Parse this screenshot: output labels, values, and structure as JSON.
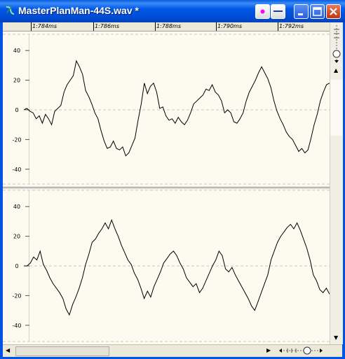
{
  "window": {
    "title": "MasterPlanMan-44S.wav *",
    "icon": "waveform-app-icon",
    "buttons": [
      "record-indicator-icon",
      "minimize-icon",
      "maximize-icon",
      "close-icon"
    ]
  },
  "colors": {
    "titlebar": "#0058e6",
    "background": "#fdfaef",
    "waveform": "#000000",
    "record_dot": "#ff00ff"
  },
  "ruler": {
    "labels": [
      "1:784ms",
      "1:786ms",
      "1:788ms",
      "1:790ms",
      "1:792ms"
    ]
  },
  "channels": [
    {
      "name": "",
      "y_ticks": [
        "40",
        "20",
        "0",
        "-20",
        "-40"
      ],
      "tick_values": [
        40,
        20,
        0,
        -20,
        -40
      ],
      "samples": [
        0,
        1,
        -1,
        -2,
        -6,
        -4,
        -9,
        -3,
        -6,
        -10,
        -1,
        1,
        3,
        12,
        17,
        20,
        23,
        33,
        29,
        24,
        13,
        9,
        4,
        -2,
        -6,
        -14,
        -21,
        -26,
        -25,
        -21,
        -26,
        -27,
        -25,
        -31,
        -29,
        -24,
        -19,
        -7,
        4,
        18,
        11,
        16,
        18,
        12,
        1,
        2,
        -4,
        -7,
        -6,
        -9,
        -5,
        -8,
        -10,
        -7,
        -2,
        4,
        6,
        8,
        10,
        14,
        13,
        17,
        12,
        10,
        6,
        -2,
        0,
        -2,
        -8,
        -9,
        -6,
        -2,
        6,
        12,
        16,
        20,
        25,
        29,
        25,
        21,
        15,
        6,
        -1,
        -6,
        -10,
        -15,
        -18,
        -20,
        -24,
        -28,
        -26,
        -29,
        -27,
        -19,
        -10,
        -3,
        6,
        12,
        17,
        18
      ]
    },
    {
      "name": "",
      "y_ticks": [
        "40",
        "20",
        "0",
        "-20",
        "-40"
      ],
      "tick_values": [
        40,
        20,
        0,
        -20,
        -40
      ],
      "samples": [
        0,
        0,
        2,
        6,
        4,
        10,
        1,
        -3,
        -8,
        -12,
        -15,
        -18,
        -22,
        -29,
        -33,
        -26,
        -21,
        -15,
        -8,
        1,
        8,
        16,
        18,
        22,
        25,
        29,
        25,
        31,
        25,
        20,
        14,
        9,
        4,
        1,
        -5,
        -9,
        -15,
        -22,
        -17,
        -21,
        -14,
        -9,
        -4,
        2,
        5,
        8,
        10,
        7,
        2,
        -2,
        -8,
        -11,
        -14,
        -12,
        -18,
        -15,
        -10,
        -5,
        0,
        4,
        10,
        7,
        -2,
        -4,
        -1,
        -6,
        -10,
        -14,
        -18,
        -22,
        -27,
        -30,
        -24,
        -18,
        -12,
        -6,
        4,
        10,
        16,
        20,
        23,
        26,
        28,
        25,
        29,
        24,
        18,
        12,
        4,
        -6,
        -10,
        -16,
        -18,
        -15,
        -19
      ]
    }
  ]
}
